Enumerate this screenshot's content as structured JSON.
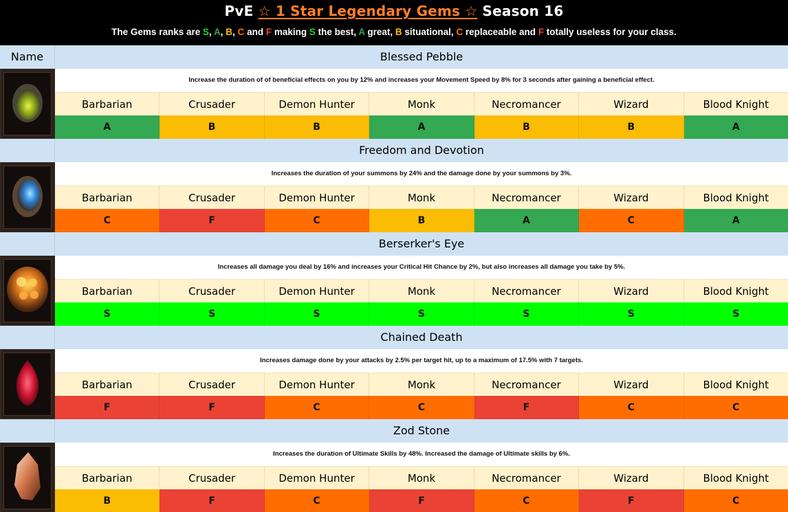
{
  "title": {
    "prefix": "PvE ",
    "accent": "☆ 1 Star Legendary Gems ☆",
    "suffix": " Season 16"
  },
  "subtitle": {
    "parts": [
      {
        "text": "The Gems ranks are ",
        "color": "#ffffff"
      },
      {
        "text": "S",
        "color": "#22d43a"
      },
      {
        "text": ", ",
        "color": "#ffffff"
      },
      {
        "text": "A",
        "color": "#34a853"
      },
      {
        "text": ", ",
        "color": "#ffffff"
      },
      {
        "text": "B",
        "color": "#fbbc04"
      },
      {
        "text": ", ",
        "color": "#ffffff"
      },
      {
        "text": "C",
        "color": "#ff6d01"
      },
      {
        "text": " and ",
        "color": "#ffffff"
      },
      {
        "text": "F",
        "color": "#ea4335"
      },
      {
        "text": " making ",
        "color": "#ffffff"
      },
      {
        "text": "S",
        "color": "#22d43a"
      },
      {
        "text": " the best, ",
        "color": "#ffffff"
      },
      {
        "text": "A",
        "color": "#34a853"
      },
      {
        "text": " great, ",
        "color": "#ffffff"
      },
      {
        "text": "B",
        "color": "#fbbc04"
      },
      {
        "text": " situational, ",
        "color": "#ffffff"
      },
      {
        "text": "C",
        "color": "#ff6d01"
      },
      {
        "text": " replaceable and ",
        "color": "#ffffff"
      },
      {
        "text": "F",
        "color": "#ea4335"
      },
      {
        "text": " totally useless for your class.",
        "color": "#ffffff"
      }
    ]
  },
  "table": {
    "name_header": "Name",
    "classes": [
      "Barbarian",
      "Crusader",
      "Demon Hunter",
      "Monk",
      "Necromancer",
      "Wizard",
      "Blood Knight"
    ],
    "grade_colors": {
      "S": "#00ff00",
      "A": "#34a853",
      "B": "#fbbc04",
      "C": "#ff6d01",
      "F": "#ea4335"
    },
    "gems": [
      {
        "name": "Blessed Pebble",
        "icon": "blessed-pebble-gem-icon",
        "description": "Increase the duration of of beneficial effects on you by 12% and increases your Movement Speed by 8% for 3 seconds after gaining a beneficial effect.",
        "grades": [
          "A",
          "B",
          "B",
          "A",
          "B",
          "B",
          "A"
        ]
      },
      {
        "name": "Freedom and Devotion",
        "icon": "freedom-and-devotion-gem-icon",
        "description": "Increases the duration of your summons by 24% and the damage done by your summons by 3%.",
        "grades": [
          "C",
          "F",
          "C",
          "B",
          "A",
          "C",
          "A"
        ]
      },
      {
        "name": "Berserker's Eye",
        "icon": "berserkers-eye-gem-icon",
        "description": "Increases all damage you deal by 16% and increases your Critical Hit Chance by 2%, but also increases all damage you take by 5%.",
        "grades": [
          "S",
          "S",
          "S",
          "S",
          "S",
          "S",
          "S"
        ]
      },
      {
        "name": "Chained Death",
        "icon": "chained-death-gem-icon",
        "description": "Increases damage done by your attacks by 2.5% per target hit, up to a maximum of 17.5% with 7 targets.",
        "grades": [
          "F",
          "F",
          "C",
          "C",
          "F",
          "C",
          "C"
        ]
      },
      {
        "name": "Zod Stone",
        "icon": "zod-stone-gem-icon",
        "description": "Increases the duration of Ultimate Skills by 48%. Increased the damage of Ultimate skills by 6%.",
        "grades": [
          "B",
          "F",
          "C",
          "F",
          "C",
          "F",
          "C"
        ]
      }
    ]
  }
}
